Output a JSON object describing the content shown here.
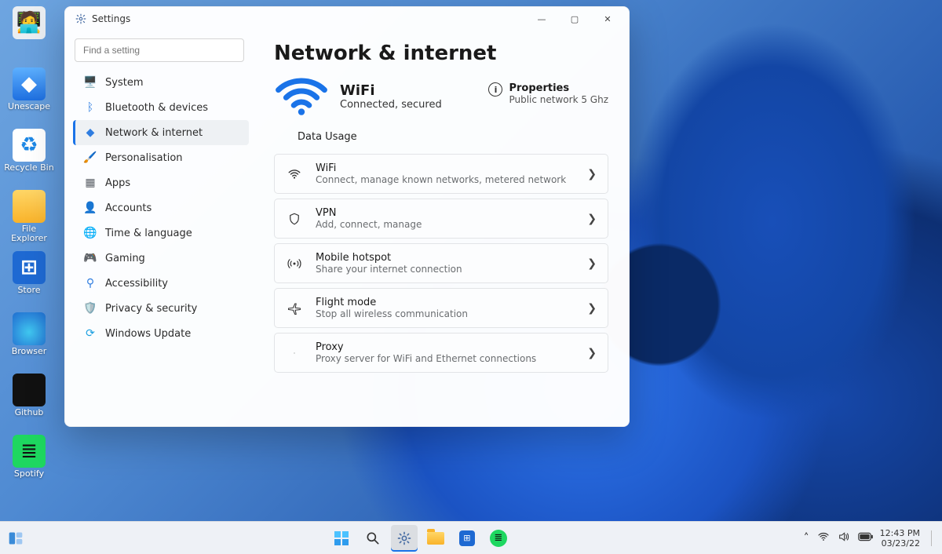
{
  "desktop_icons": [
    {
      "label": "",
      "glyph": "🧑‍💻",
      "class": "g-user"
    },
    {
      "label": "Unescape",
      "glyph": "◆",
      "class": "g-cube"
    },
    {
      "label": "Recycle Bin",
      "glyph": "♻",
      "class": "g-bin"
    },
    {
      "label": "File Explorer",
      "glyph": "",
      "class": "g-folder"
    },
    {
      "label": "Store",
      "glyph": "⊞",
      "class": "g-store"
    },
    {
      "label": "Browser",
      "glyph": "",
      "class": "g-browser"
    },
    {
      "label": "Github",
      "glyph": "",
      "class": "g-github"
    },
    {
      "label": "Spotify",
      "glyph": "≣",
      "class": "g-spotify"
    }
  ],
  "window": {
    "title": "Settings",
    "controls": {
      "min": "—",
      "max": "▢",
      "close": "✕"
    }
  },
  "search": {
    "placeholder": "Find a setting"
  },
  "nav": [
    {
      "label": "System",
      "icon": "🖥️",
      "color": "#3a8bd8"
    },
    {
      "label": "Bluetooth & devices",
      "icon": "ᛒ",
      "color": "#2f7de0"
    },
    {
      "label": "Network & internet",
      "icon": "◆",
      "color": "#2f7de0",
      "active": true
    },
    {
      "label": "Personalisation",
      "icon": "🖌️",
      "color": "#c98a3b"
    },
    {
      "label": "Apps",
      "icon": "▦",
      "color": "#5a5f66"
    },
    {
      "label": "Accounts",
      "icon": "👤",
      "color": "#45b06b"
    },
    {
      "label": "Time & language",
      "icon": "🌐",
      "color": "#2f7de0"
    },
    {
      "label": "Gaming",
      "icon": "🎮",
      "color": "#7a8089"
    },
    {
      "label": "Accessibility",
      "icon": "⚲",
      "color": "#2f7de0"
    },
    {
      "label": "Privacy & security",
      "icon": "🛡️",
      "color": "#8a9099"
    },
    {
      "label": "Windows Update",
      "icon": "⟳",
      "color": "#1a9fe0"
    }
  ],
  "page": {
    "title": "Network & internet",
    "wifi_name": "WiFi",
    "wifi_status": "Connected, secured",
    "properties_title": "Properties",
    "properties_sub": "Public network 5 Ghz",
    "data_usage": "Data Usage"
  },
  "cards": [
    {
      "title": "WiFi",
      "sub": "Connect, manage known networks, metered network"
    },
    {
      "title": "VPN",
      "sub": "Add, connect, manage"
    },
    {
      "title": "Mobile hotspot",
      "sub": "Share your internet connection"
    },
    {
      "title": "Flight mode",
      "sub": "Stop all wireless communication"
    },
    {
      "title": "Proxy",
      "sub": "Proxy server for WiFi and Ethernet connections"
    }
  ],
  "taskbar": {
    "time": "12:43 PM",
    "date": "03/23/22"
  }
}
